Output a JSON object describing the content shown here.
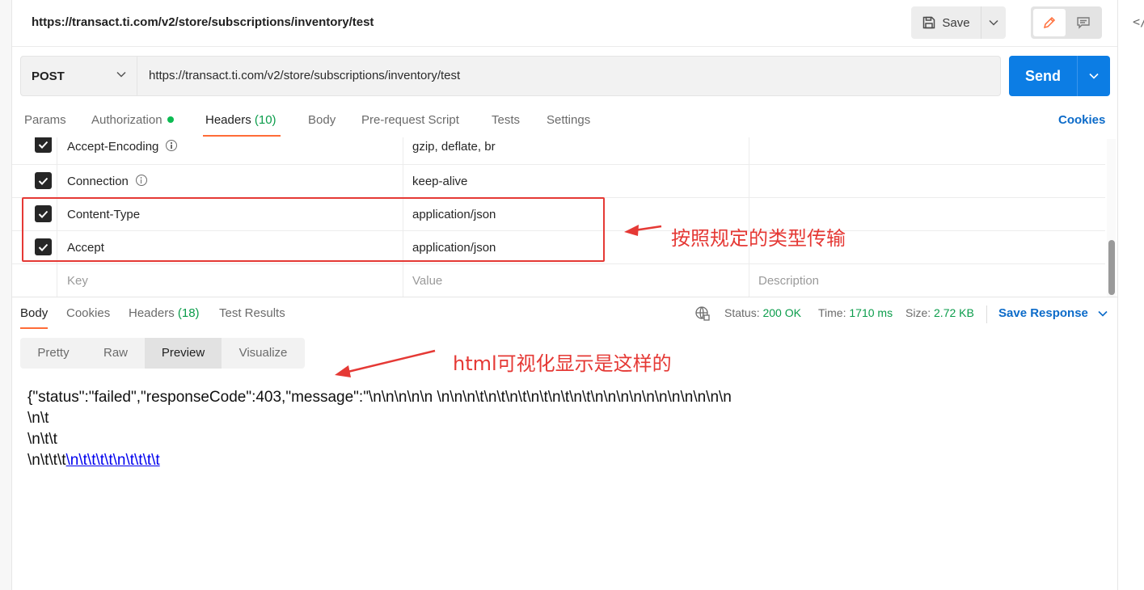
{
  "title_bar": {
    "request_title": "https://transact.ti.com/v2/store/subscriptions/inventory/test",
    "save_label": "Save"
  },
  "request": {
    "method": "POST",
    "url": "https://transact.ti.com/v2/store/subscriptions/inventory/test",
    "send_label": "Send"
  },
  "request_tabs": {
    "params": "Params",
    "authorization": "Authorization",
    "headers": "Headers",
    "headers_count": "(10)",
    "body": "Body",
    "pre_request": "Pre-request Script",
    "tests": "Tests",
    "settings": "Settings",
    "cookies": "Cookies"
  },
  "headers_table": {
    "rows": [
      {
        "key": "Accept-Encoding",
        "value": "gzip, deflate, br",
        "checked": true,
        "info": true
      },
      {
        "key": "Connection",
        "value": "keep-alive",
        "checked": true,
        "info": true
      },
      {
        "key": "Content-Type",
        "value": "application/json",
        "checked": true,
        "info": false
      },
      {
        "key": "Accept",
        "value": "application/json",
        "checked": true,
        "info": false
      }
    ],
    "placeholder": {
      "key": "Key",
      "value": "Value",
      "description": "Description"
    }
  },
  "annotations": {
    "headers_note": "按照规定的类型传输",
    "preview_note": "html可视化显示是这样的",
    "color": "#e53935"
  },
  "response_tabs": {
    "body": "Body",
    "cookies": "Cookies",
    "headers": "Headers",
    "headers_count": "(18)",
    "test_results": "Test Results"
  },
  "response_meta": {
    "status_label": "Status:",
    "status_value": "200 OK",
    "time_label": "Time:",
    "time_value": "1710 ms",
    "size_label": "Size:",
    "size_value": "2.72 KB",
    "save_response": "Save Response"
  },
  "view_modes": {
    "pretty": "Pretty",
    "raw": "Raw",
    "preview": "Preview",
    "visualize": "Visualize",
    "active": "Preview"
  },
  "preview": {
    "line1": "{\"status\":\"failed\",\"responseCode\":403,\"message\":\"\\n\\n\\n\\n\\n \\n\\n\\n\\t\\n\\t\\n\\t\\n\\t\\n\\t\\n\\t\\n\\n\\n\\n\\n\\n\\n\\n\\n\\n\\n",
    "line2": "\\n\\t",
    "line3": "\\n\\t\\t",
    "line4_text": "\\n\\t\\t\\t",
    "line4_link": "\\n\\t\\t\\t\\t\\n\\t\\t\\t\\t"
  },
  "colors": {
    "send_blue": "#0c7de4",
    "link_blue": "#0c6bc9",
    "active_tab_orange": "#ff6c37",
    "count_green": "#0a9c4a"
  }
}
